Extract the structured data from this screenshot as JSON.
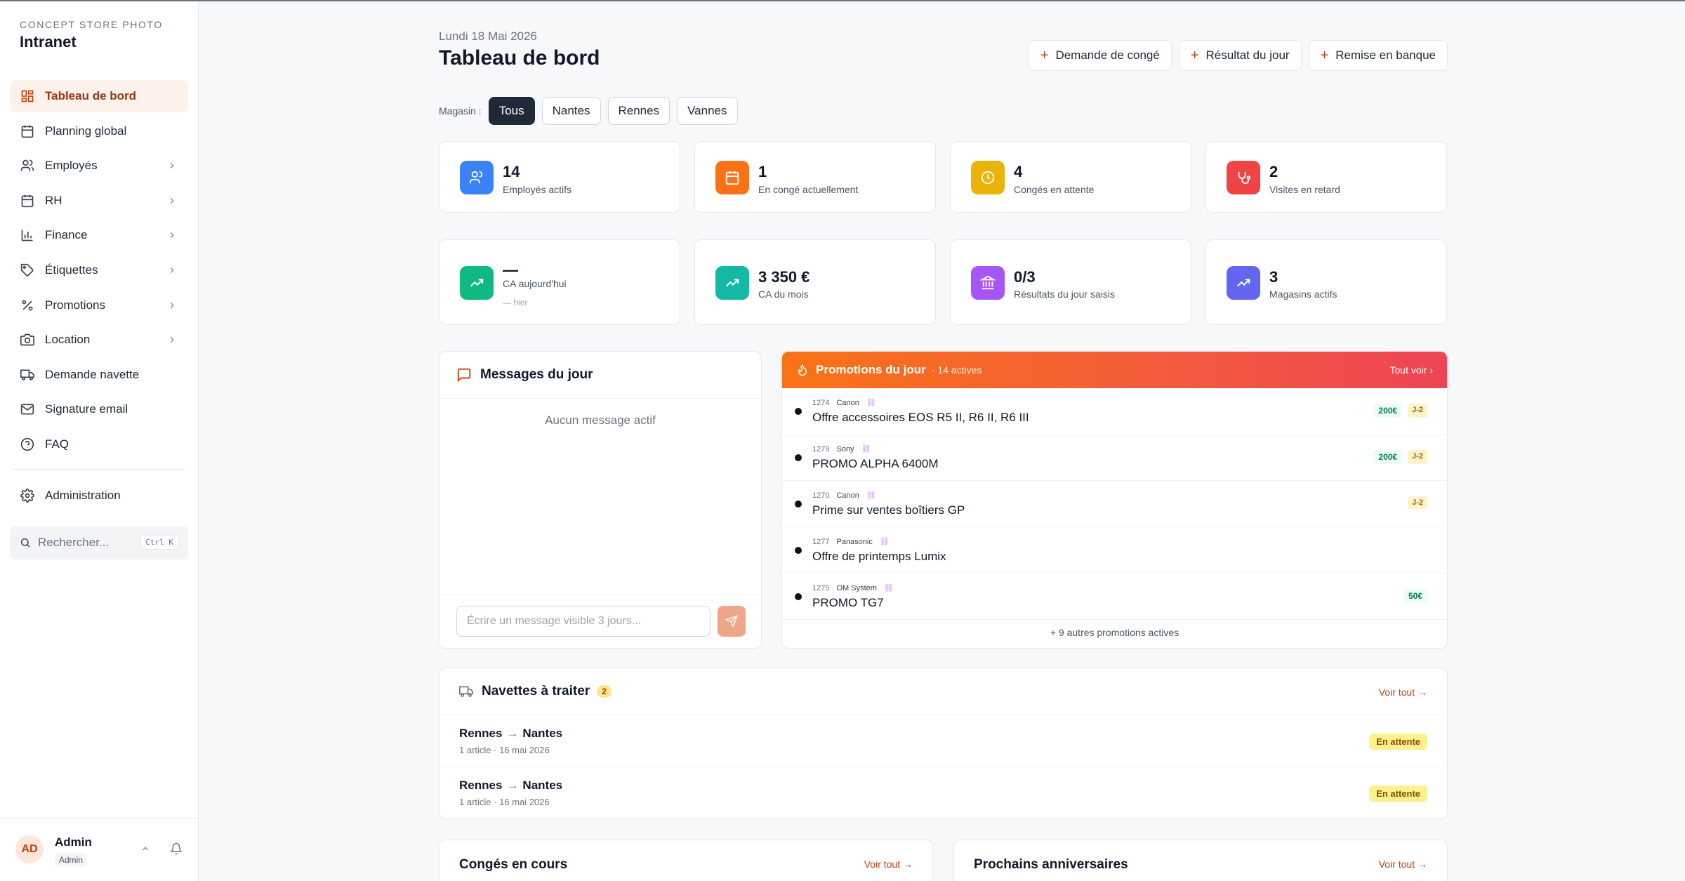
{
  "brand": {
    "subtitle": "CONCEPT STORE PHOTO",
    "title": "Intranet"
  },
  "sidebar": {
    "items": [
      {
        "label": "Tableau de bord",
        "icon": "dashboard-icon",
        "active": true,
        "chevron": false
      },
      {
        "label": "Planning global",
        "icon": "calendar-icon",
        "chevron": false
      },
      {
        "label": "Employés",
        "icon": "users-icon",
        "chevron": true
      },
      {
        "label": "RH",
        "icon": "calendar-icon",
        "chevron": true
      },
      {
        "label": "Finance",
        "icon": "bar-chart-icon",
        "chevron": true
      },
      {
        "label": "Étiquettes",
        "icon": "tag-icon",
        "chevron": true
      },
      {
        "label": "Promotions",
        "icon": "percent-icon",
        "chevron": true
      },
      {
        "label": "Location",
        "icon": "camera-icon",
        "chevron": true
      },
      {
        "label": "Demande navette",
        "icon": "truck-icon",
        "chevron": false
      },
      {
        "label": "Signature email",
        "icon": "mail-icon",
        "chevron": false
      },
      {
        "label": "FAQ",
        "icon": "help-circle-icon",
        "chevron": false
      }
    ],
    "admin": {
      "label": "Administration",
      "icon": "gear-icon"
    },
    "search": {
      "placeholder": "Rechercher...",
      "shortcut": "Ctrl K"
    },
    "user": {
      "initials": "AD",
      "name": "Admin",
      "role": "Admin"
    }
  },
  "header": {
    "date": "Lundi 18 Mai 2026",
    "title": "Tableau de bord",
    "actions": [
      "Demande de congé",
      "Résultat du jour",
      "Remise en banque"
    ]
  },
  "stores": {
    "label": "Magasin :",
    "options": [
      "Tous",
      "Nantes",
      "Rennes",
      "Vannes"
    ],
    "selected": "Tous"
  },
  "stats_row1": [
    {
      "value": "14",
      "label": "Employés actifs",
      "color": "#3b82f6",
      "icon": "users-icon"
    },
    {
      "value": "1",
      "label": "En congé actuellement",
      "color": "#f97316",
      "icon": "calendar-icon"
    },
    {
      "value": "4",
      "label": "Congés en attente",
      "color": "#eab308",
      "icon": "clock-icon"
    },
    {
      "value": "2",
      "label": "Visites en retard",
      "color": "#ef4444",
      "icon": "stethoscope-icon"
    }
  ],
  "stats_row2": [
    {
      "value": "—",
      "label": "CA aujourd'hui",
      "sub": "— hier",
      "color": "#10b981",
      "icon": "trend-up-icon"
    },
    {
      "value": "3 350 €",
      "label": "CA du mois",
      "color": "#14b8a6",
      "icon": "trend-up-icon"
    },
    {
      "value": "0/3",
      "label": "Résultats du jour saisis",
      "color": "#a855f7",
      "icon": "bank-icon"
    },
    {
      "value": "3",
      "label": "Magasins actifs",
      "color": "#6366f1",
      "icon": "trend-up-icon"
    }
  ],
  "messages": {
    "title": "Messages du jour",
    "empty": "Aucun message actif",
    "input_placeholder": "Écrire un message visible 3 jours..."
  },
  "promotions": {
    "title": "Promotions du jour",
    "count": "· 14 actives",
    "see_all": "Tout voir",
    "rows": [
      {
        "id": "1274",
        "brand": "Canon",
        "name": "Offre accessoires EOS R5 II, R6 II, R6 III",
        "amount": "200€",
        "deadline": "J-2"
      },
      {
        "id": "1279",
        "brand": "Sony",
        "name": "PROMO ALPHA 6400M",
        "amount": "200€",
        "deadline": "J-2"
      },
      {
        "id": "1270",
        "brand": "Canon",
        "name": "Prime sur ventes boîtiers GP",
        "amount": "",
        "deadline": "J-2"
      },
      {
        "id": "1277",
        "brand": "Panasonic",
        "name": "Offre de printemps Lumix",
        "amount": "",
        "deadline": ""
      },
      {
        "id": "1275",
        "brand": "OM System",
        "name": "PROMO TG7",
        "amount": "50€",
        "deadline": ""
      }
    ],
    "more": "+ 9 autres promotions actives"
  },
  "shuttles": {
    "title": "Navettes à traiter",
    "count": "2",
    "see_all": "Voir tout",
    "rows": [
      {
        "from": "Rennes",
        "to": "Nantes",
        "info": "1 article · 16 mai 2026",
        "status": "En attente"
      },
      {
        "from": "Rennes",
        "to": "Nantes",
        "info": "1 article · 16 mai 2026",
        "status": "En attente"
      }
    ]
  },
  "leaves": {
    "title": "Congés en cours",
    "see_all": "Voir tout"
  },
  "birthdays": {
    "title": "Prochains anniversaires",
    "see_all": "Voir tout"
  },
  "colors": {
    "accent": "#c2410c",
    "active_bg": "#fdf1ec",
    "dark_chip": "#1f2937"
  }
}
